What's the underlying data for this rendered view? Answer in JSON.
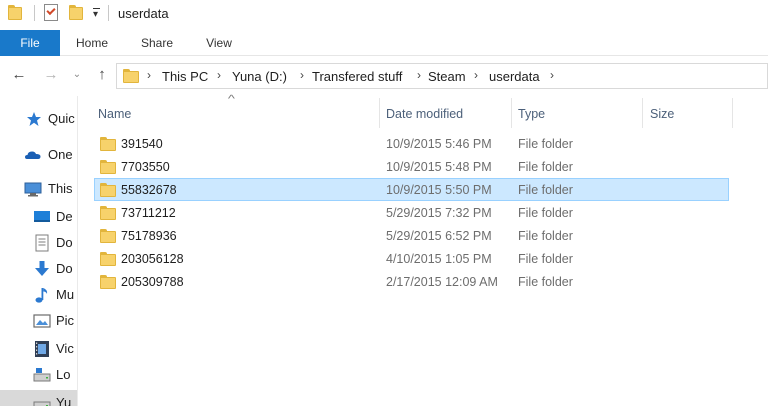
{
  "window": {
    "title": "userdata"
  },
  "quick_access_toolbar": {
    "icons": [
      "folder-icon",
      "properties-icon",
      "new-folder-icon",
      "customize-dropdown-icon"
    ]
  },
  "ribbon": {
    "tabs": [
      "File",
      "Home",
      "Share",
      "View"
    ]
  },
  "navigation": {
    "back_glyph": "←",
    "forward_glyph": "→",
    "recent_glyph": "⌄",
    "up_glyph": "↑"
  },
  "address_bar": {
    "separator": "›",
    "breadcrumbs": [
      "This PC",
      "Yuna (D:)",
      "Transfered stuff",
      "Steam",
      "userdata"
    ]
  },
  "nav_pane": {
    "items": [
      {
        "label": "Quic",
        "icon": "star-icon"
      },
      {
        "label": "One",
        "icon": "cloud-icon"
      },
      {
        "label": "This",
        "icon": "computer-icon"
      },
      {
        "label": "De",
        "icon": "desktop-icon"
      },
      {
        "label": "Do",
        "icon": "document-icon"
      },
      {
        "label": "Do",
        "icon": "download-icon"
      },
      {
        "label": "Mu",
        "icon": "music-icon"
      },
      {
        "label": "Pic",
        "icon": "pictures-icon"
      },
      {
        "label": "Vic",
        "icon": "videos-icon"
      },
      {
        "label": "Lo",
        "icon": "local-disk-icon"
      },
      {
        "label": "Yu",
        "icon": "drive-icon"
      }
    ]
  },
  "columns": {
    "name": "Name",
    "date_modified": "Date modified",
    "type": "Type",
    "size": "Size",
    "sort_indicator": "^"
  },
  "files": [
    {
      "name": "391540",
      "date": "10/9/2015 5:46 PM",
      "type": "File folder",
      "selected": false
    },
    {
      "name": "7703550",
      "date": "10/9/2015 5:48 PM",
      "type": "File folder",
      "selected": false
    },
    {
      "name": "55832678",
      "date": "10/9/2015 5:50 PM",
      "type": "File folder",
      "selected": true
    },
    {
      "name": "73711212",
      "date": "5/29/2015 7:32 PM",
      "type": "File folder",
      "selected": false
    },
    {
      "name": "75178936",
      "date": "5/29/2015 6:52 PM",
      "type": "File folder",
      "selected": false
    },
    {
      "name": "203056128",
      "date": "4/10/2015 1:05 PM",
      "type": "File folder",
      "selected": false
    },
    {
      "name": "205309788",
      "date": "2/17/2015 12:09 AM",
      "type": "File folder",
      "selected": false
    }
  ],
  "colors": {
    "file_tab": "#1979ca",
    "selection_fill": "#cce8ff",
    "selection_border": "#99d1ff",
    "folder_yellow": "#f7d26b"
  }
}
